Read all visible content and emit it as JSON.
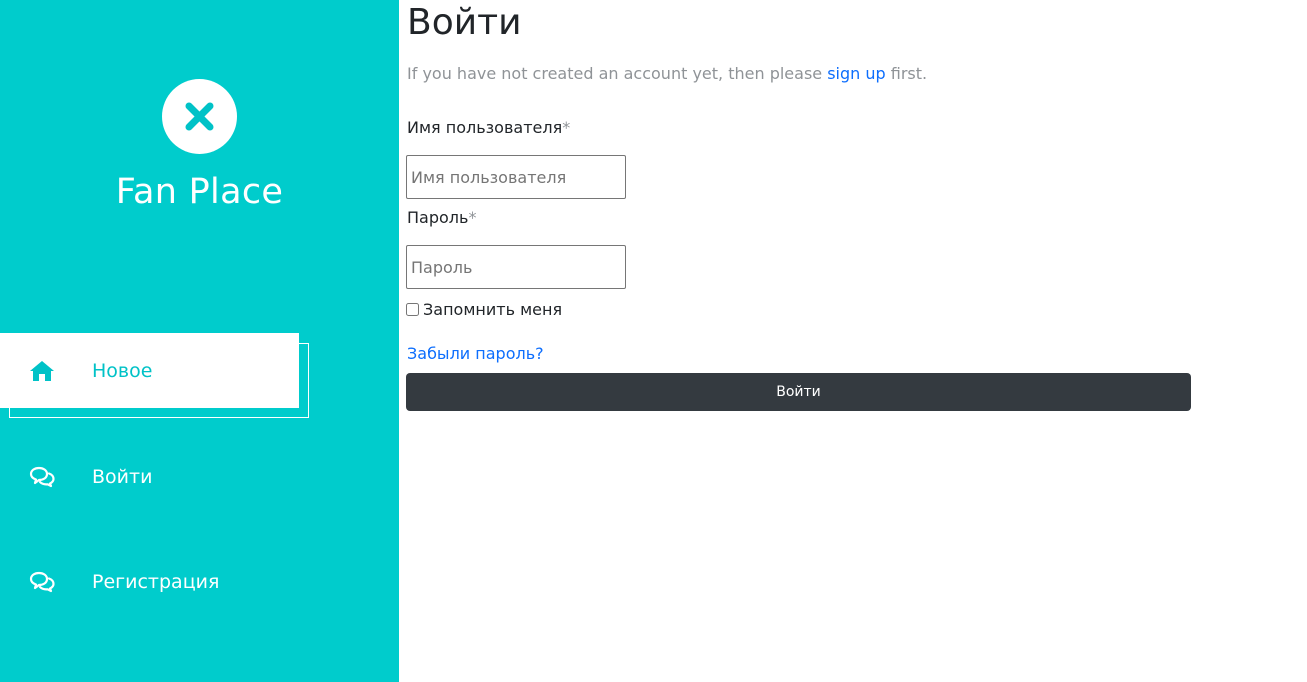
{
  "sidebar": {
    "brand": "Fan Place",
    "logo_icon": "close-x-icon",
    "items": [
      {
        "label": "Новое",
        "icon": "home-icon",
        "active": true
      },
      {
        "label": "Войти",
        "icon": "chat-bubbles-icon",
        "active": false
      },
      {
        "label": "Регистрация",
        "icon": "chat-bubbles-icon",
        "active": false
      }
    ]
  },
  "form": {
    "title": "Войти",
    "intro_prefix": "If you have not created an account yet, then please ",
    "intro_link": "sign up",
    "intro_suffix": " first.",
    "username_label": "Имя пользователя",
    "username_placeholder": "Имя пользователя",
    "username_value": "",
    "password_label": "Пароль",
    "password_placeholder": "Пароль",
    "password_value": "",
    "required_mark": "*",
    "remember_label": "Запомнить меня",
    "remember_checked": false,
    "forgot_link": "Забыли пароль?",
    "submit_label": "Войти"
  },
  "colors": {
    "sidebar_bg": "#00cccc",
    "accent_text": "#00c2c7",
    "link": "#0d6efd",
    "button_bg": "#343a40"
  }
}
